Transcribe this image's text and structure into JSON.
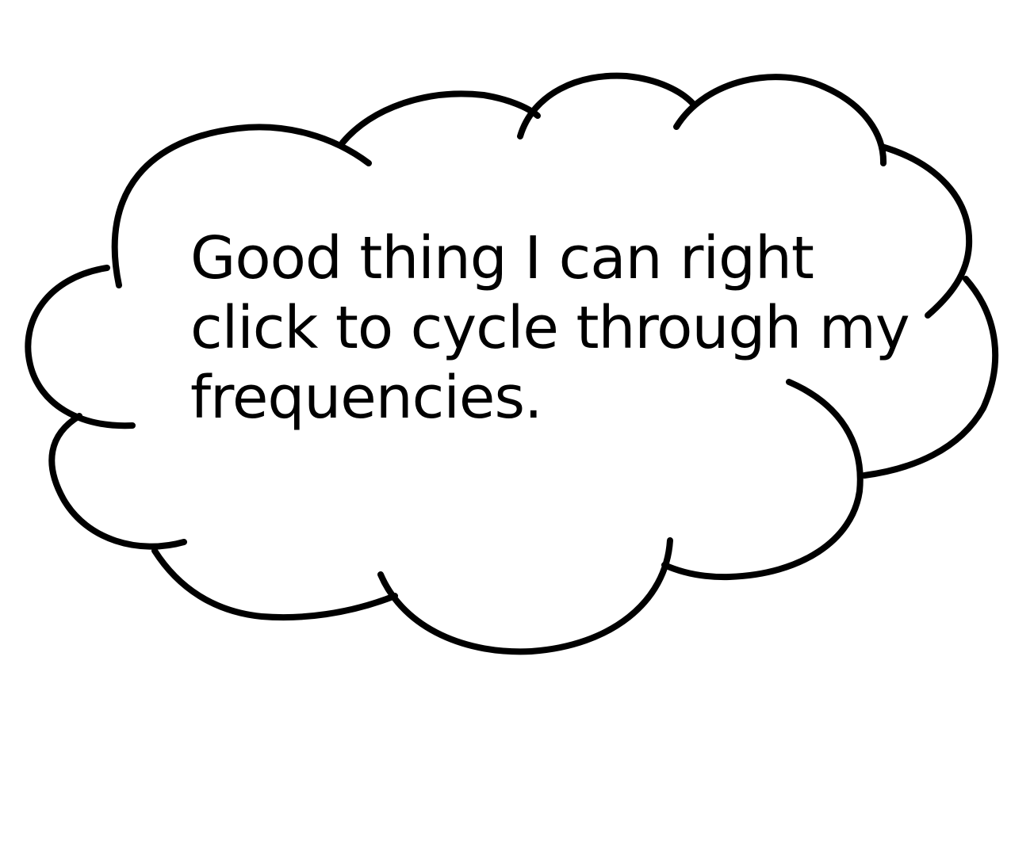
{
  "thought_bubble": {
    "lines": [
      "Good thing I can right",
      "click to cycle through my",
      "frequencies."
    ]
  },
  "colors": {
    "outline": "#000000",
    "background": "#ffffff",
    "text": "#000000"
  },
  "icons": [
    "thought-cloud-icon"
  ]
}
